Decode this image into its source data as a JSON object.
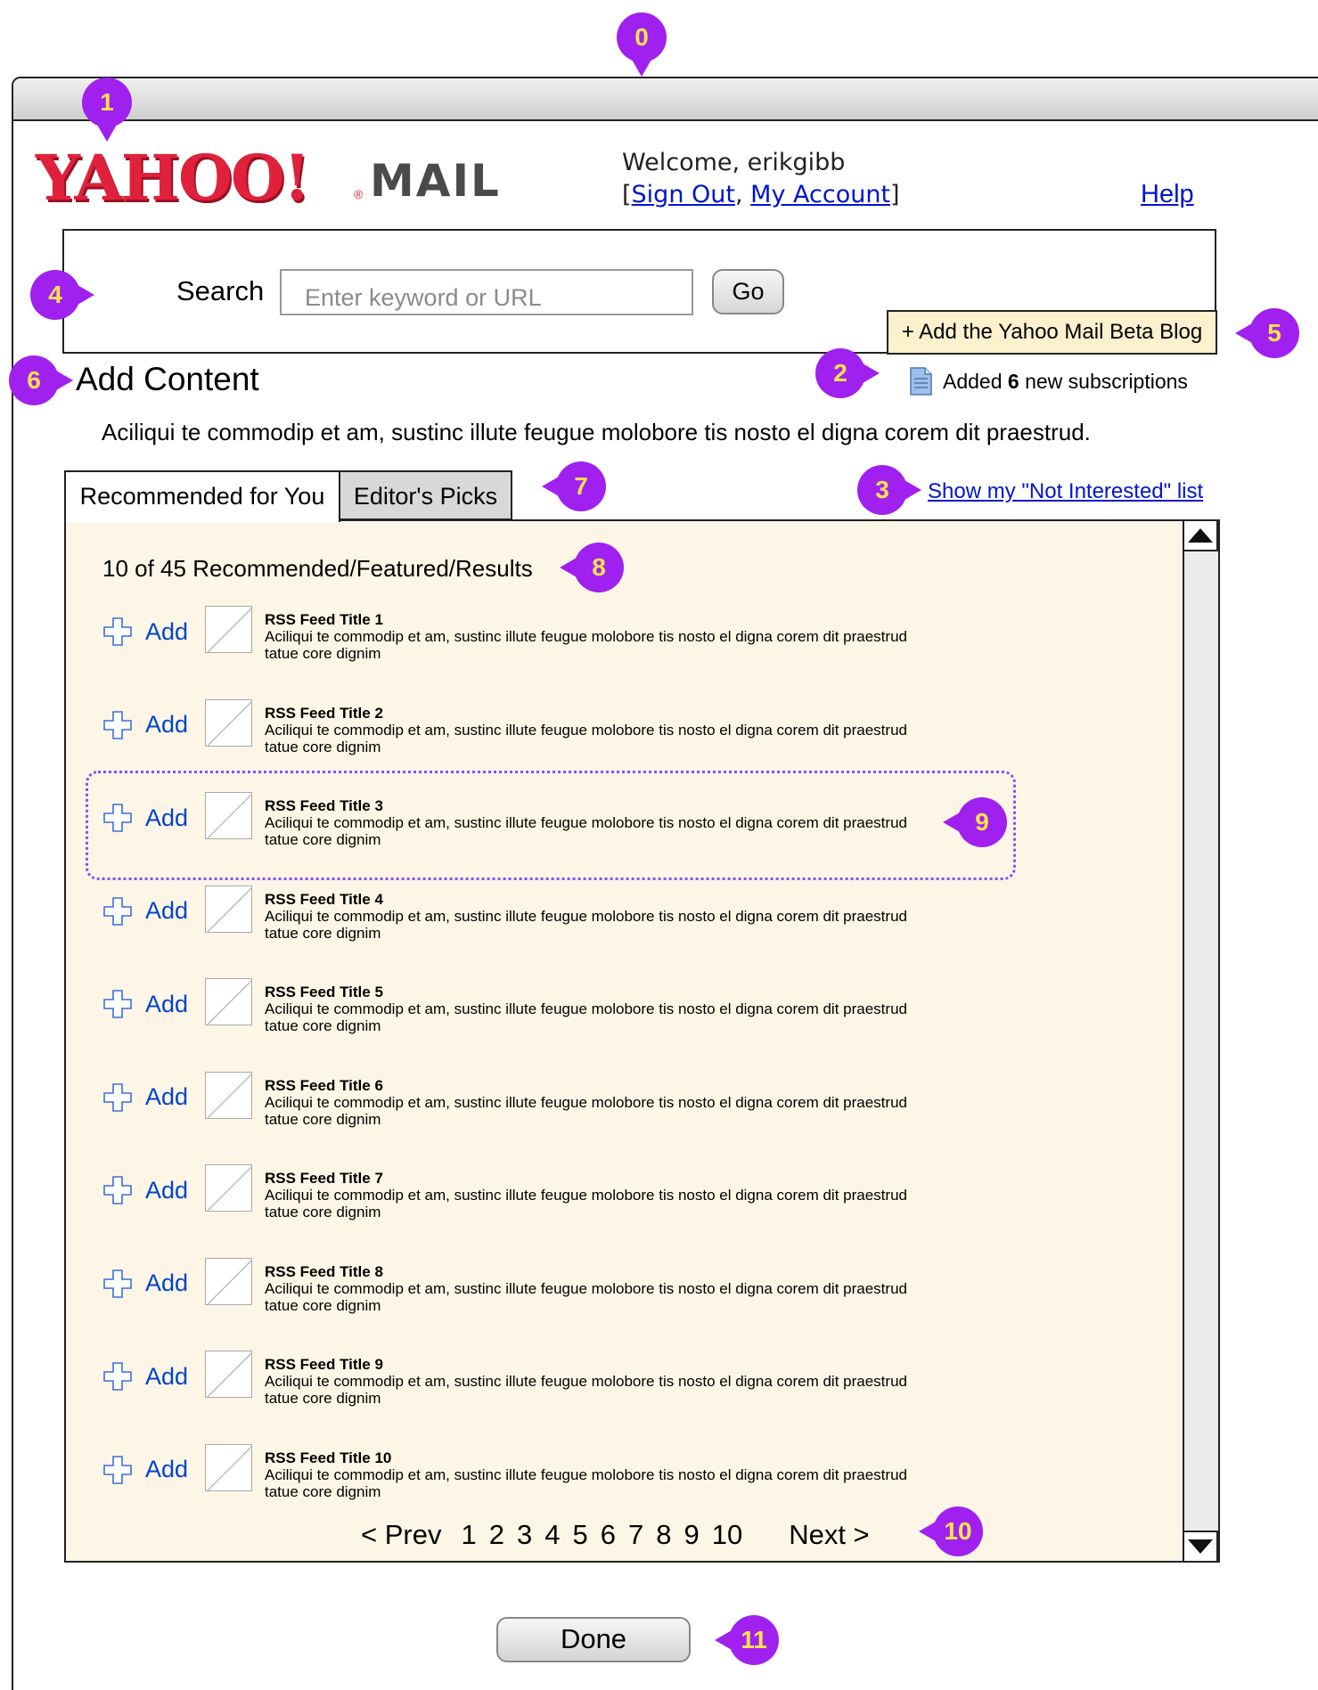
{
  "header": {
    "logo_text": "YAHOO!",
    "logo_product": "MAIL",
    "welcome_text": "Welcome, erikgibb",
    "sign_out_label": "Sign Out",
    "my_account_label": "My Account",
    "help_label": "Help"
  },
  "search": {
    "label": "Search",
    "placeholder": "Enter keyword or URL",
    "value": "",
    "go_label": "Go",
    "beta_blog_label": "+ Add the Yahoo Mail Beta Blog"
  },
  "content": {
    "title": "Add Content",
    "added_prefix": "Added",
    "added_count": "6",
    "added_suffix": "new subscriptions",
    "intro": "Aciliqui te commodip et am, sustinc illute feugue molobore tis nosto el digna corem dit praestrud.",
    "not_interested_label": "Show my \"Not Interested\" list"
  },
  "tabs": [
    {
      "label": "Recommended for You",
      "active": true
    },
    {
      "label": "Editor's Picks",
      "active": false
    }
  ],
  "results": {
    "count_text": "10 of 45 Recommended/Featured/Results",
    "add_label": "Add",
    "items": [
      {
        "title": "RSS Feed Title 1",
        "description": "Aciliqui te commodip et am, sustinc illute feugue molobore tis nosto el digna corem dit praestrud tatue core dignim"
      },
      {
        "title": "RSS Feed Title 2",
        "description": "Aciliqui te commodip et am, sustinc illute feugue molobore tis nosto el digna corem dit praestrud tatue core dignim"
      },
      {
        "title": "RSS Feed Title 3",
        "description": "Aciliqui te commodip et am, sustinc illute feugue molobore tis nosto el digna corem dit praestrud tatue core dignim"
      },
      {
        "title": "RSS Feed Title 4",
        "description": "Aciliqui te commodip et am, sustinc illute feugue molobore tis nosto el digna corem dit praestrud tatue core dignim"
      },
      {
        "title": "RSS Feed Title 5",
        "description": "Aciliqui te commodip et am, sustinc illute feugue molobore tis nosto el digna corem dit praestrud tatue core dignim"
      },
      {
        "title": "RSS Feed Title 6",
        "description": "Aciliqui te commodip et am, sustinc illute feugue molobore tis nosto el digna corem dit praestrud tatue core dignim"
      },
      {
        "title": "RSS Feed Title 7",
        "description": "Aciliqui te commodip et am, sustinc illute feugue molobore tis nosto el digna corem dit praestrud tatue core dignim"
      },
      {
        "title": "RSS Feed Title 8",
        "description": "Aciliqui te commodip et am, sustinc illute feugue molobore tis nosto el digna corem dit praestrud tatue core dignim"
      },
      {
        "title": "RSS Feed Title 9",
        "description": "Aciliqui te commodip et am, sustinc illute feugue molobore tis nosto el digna corem dit praestrud tatue core dignim"
      },
      {
        "title": "RSS Feed Title 10",
        "description": "Aciliqui te commodip et am, sustinc illute feugue molobore tis nosto el digna corem dit praestrud tatue core dignim"
      }
    ]
  },
  "pagination": {
    "prev_label": "< Prev",
    "pages": [
      "1",
      "2",
      "3",
      "4",
      "5",
      "6",
      "7",
      "8",
      "9",
      "10"
    ],
    "next_label": "Next >"
  },
  "done_label": "Done",
  "annotations": [
    "0",
    "1",
    "2",
    "3",
    "4",
    "5",
    "6",
    "7",
    "8",
    "9",
    "10",
    "11"
  ],
  "colors": {
    "callout": "#a020f0",
    "callout_text": "#ffe34a",
    "link": "#0015cc",
    "panel_bg": "#fdf6e6",
    "blog_bg": "#fdf0cd",
    "logo_red": "#e0213c"
  },
  "icons": {
    "add": "plus-outline-icon",
    "added_note": "document-icon",
    "scroll_up": "triangle-up-icon",
    "scroll_down": "triangle-down-icon",
    "thumbnail": "image-placeholder-icon"
  }
}
